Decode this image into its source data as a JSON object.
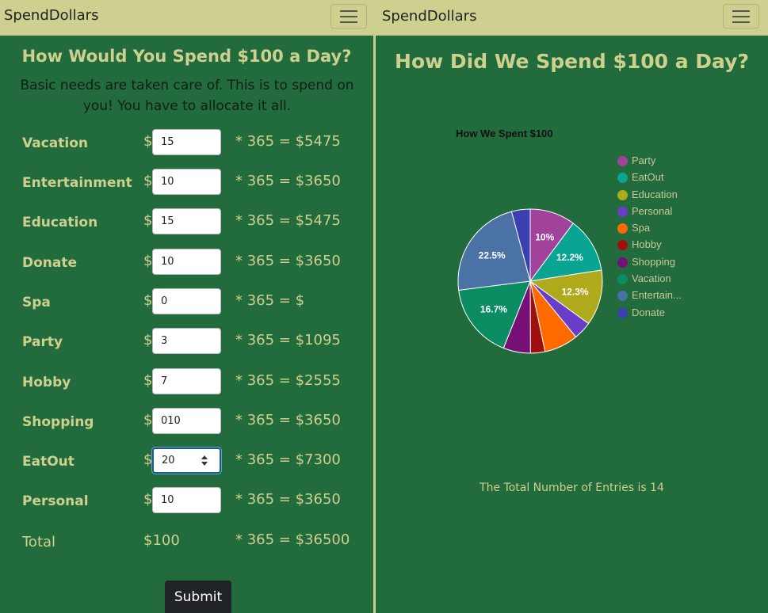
{
  "left": {
    "brand": "SpendDollars",
    "title": "How Would You Spend $100 a Day?",
    "subtitle": "Basic needs are taken care of. This is to spend on you! You have to allocate it all.",
    "currency": "$",
    "rows": [
      {
        "label": "Vacation",
        "value": "15",
        "calc": "* 365 = $5475"
      },
      {
        "label": "Entertainment",
        "value": "10",
        "calc": "* 365 = $3650"
      },
      {
        "label": "Education",
        "value": "15",
        "calc": "* 365 = $5475"
      },
      {
        "label": "Donate",
        "value": "10",
        "calc": "* 365 = $3650"
      },
      {
        "label": "Spa",
        "value": "0",
        "calc": "* 365 = $"
      },
      {
        "label": "Party",
        "value": "3",
        "calc": "* 365 = $1095"
      },
      {
        "label": "Hobby",
        "value": "7",
        "calc": "* 365 = $2555"
      },
      {
        "label": "Shopping",
        "value": "010",
        "calc": "* 365 = $3650"
      },
      {
        "label": "EatOut",
        "value": "20",
        "calc": "* 365 = $7300"
      },
      {
        "label": "Personal",
        "value": "10",
        "calc": "* 365 = $3650"
      }
    ],
    "total": {
      "label": "Total",
      "amount": "$100",
      "calc": "* 365 = $36500"
    },
    "submit_label": "Submit"
  },
  "right": {
    "brand": "SpendDollars",
    "title": "How Did We Spend $100 a Day?",
    "entries_text": "The Total Number of Entries is 14"
  },
  "chart_data": {
    "type": "pie",
    "title": "How We Spent $100",
    "legend_position": "right",
    "series": [
      {
        "name": "Party",
        "value": 10.0,
        "color": "#a2439b",
        "label": "10%"
      },
      {
        "name": "EatOut",
        "value": 12.2,
        "color": "#0aa592",
        "label": "12.2%"
      },
      {
        "name": "Education",
        "value": 12.3,
        "color": "#aeaa1c",
        "label": "12.3%"
      },
      {
        "name": "Personal",
        "value": 4.0,
        "color": "#6a3dc8",
        "label": ""
      },
      {
        "name": "Spa",
        "value": 7.5,
        "color": "#ff6a00",
        "label": ""
      },
      {
        "name": "Hobby",
        "value": 3.2,
        "color": "#a00f0f",
        "label": ""
      },
      {
        "name": "Shopping",
        "value": 6.0,
        "color": "#760f76",
        "label": ""
      },
      {
        "name": "Vacation",
        "value": 16.7,
        "color": "#0b8c62",
        "label": "16.7%"
      },
      {
        "name": "Entertain...",
        "value": 22.5,
        "color": "#4a72a4",
        "label": "22.5%"
      },
      {
        "name": "Donate",
        "value": 4.1,
        "color": "#3a3fb2",
        "label": ""
      }
    ]
  }
}
